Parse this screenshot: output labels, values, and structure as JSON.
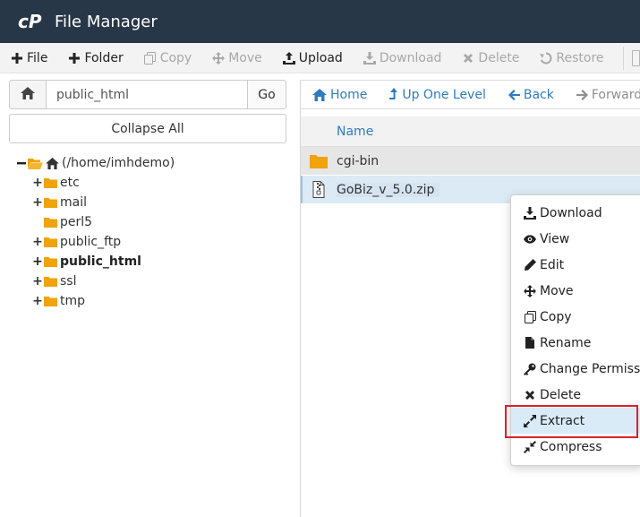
{
  "app": {
    "title": "File Manager",
    "logo": "cP"
  },
  "toolbar": {
    "items": [
      {
        "label": "File",
        "icon": "plus-icon",
        "enabled": true
      },
      {
        "label": "Folder",
        "icon": "plus-icon",
        "enabled": true
      },
      {
        "label": "Copy",
        "icon": "copy-icon",
        "enabled": false
      },
      {
        "label": "Move",
        "icon": "move-icon",
        "enabled": false
      },
      {
        "label": "Upload",
        "icon": "upload-icon",
        "enabled": true
      },
      {
        "label": "Download",
        "icon": "download-icon",
        "enabled": false
      },
      {
        "label": "Delete",
        "icon": "delete-icon",
        "enabled": false
      },
      {
        "label": "Restore",
        "icon": "restore-icon",
        "enabled": false
      }
    ]
  },
  "path_bar": {
    "value": "public_html",
    "go_label": "Go"
  },
  "tree": {
    "collapse_label": "Collapse All",
    "root_label": "(/home/imhdemo)",
    "items": [
      {
        "label": "etc",
        "toggle": "+",
        "selected": false
      },
      {
        "label": "mail",
        "toggle": "+",
        "selected": false
      },
      {
        "label": "perl5",
        "toggle": "",
        "selected": false
      },
      {
        "label": "public_ftp",
        "toggle": "+",
        "selected": false
      },
      {
        "label": "public_html",
        "toggle": "+",
        "selected": true
      },
      {
        "label": "ssl",
        "toggle": "+",
        "selected": false
      },
      {
        "label": "tmp",
        "toggle": "+",
        "selected": false
      }
    ]
  },
  "nav": {
    "home_label": "Home",
    "up_label": "Up One Level",
    "back_label": "Back",
    "forward_label": "Forward"
  },
  "table": {
    "name_header": "Name",
    "rows": [
      {
        "name": "cgi-bin",
        "type": "folder"
      },
      {
        "name": "GoBiz_v_5.0.zip",
        "type": "zip"
      }
    ]
  },
  "context_menu": {
    "items": [
      {
        "label": "Download",
        "icon": "download-icon"
      },
      {
        "label": "View",
        "icon": "eye-icon"
      },
      {
        "label": "Edit",
        "icon": "pencil-icon"
      },
      {
        "label": "Move",
        "icon": "move-icon"
      },
      {
        "label": "Copy",
        "icon": "copy-icon"
      },
      {
        "label": "Rename",
        "icon": "file-icon"
      },
      {
        "label": "Change Permissions",
        "icon": "key-icon"
      },
      {
        "label": "Delete",
        "icon": "delete-icon"
      },
      {
        "label": "Extract",
        "icon": "expand-icon",
        "highlighted": true
      },
      {
        "label": "Compress",
        "icon": "compress-icon"
      }
    ]
  },
  "colors": {
    "header_bg": "#283747",
    "link_blue": "#2e7cc2",
    "folder_orange": "#f0a30a",
    "highlight_red": "#d8232a",
    "selection_blue": "#dbeaf5"
  }
}
